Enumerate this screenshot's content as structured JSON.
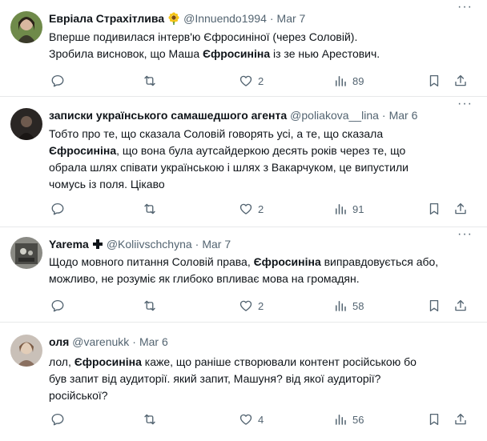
{
  "tweets": [
    {
      "name": "Евріала Страхітлива",
      "handle": "@Innuendo1994",
      "separator": "·",
      "date": "Mar 7",
      "badge_icon": "sunflower-emoji",
      "text_parts": [
        {
          "t": "Вперше подивилася інтерв'ю Єфросиніної (через Соловій).\nЗробила висновок, що Маша "
        },
        {
          "t": "Єфросиніна",
          "b": true
        },
        {
          "t": " із зе нью Арестович."
        }
      ],
      "likes": "2",
      "views": "89"
    },
    {
      "name": "записки українського самашедшого агента",
      "handle": "@poliakova__lina",
      "separator": "·",
      "date": "Mar 6",
      "text_parts": [
        {
          "t": "Тобто про те, що сказала Соловій говорять усі, а те, що сказала\n"
        },
        {
          "t": "Єфросиніна",
          "b": true
        },
        {
          "t": ", що вона була аутсайдеркою десять років через те, що\nобрала шлях співати українською і шлях з Вакарчуком, це випустили\nчомусь із поля. Цікаво"
        }
      ],
      "likes": "2",
      "views": "91"
    },
    {
      "name": "Yarema",
      "handle": "@Koliivschchyna",
      "separator": "·",
      "date": "Mar 7",
      "badge_icon": "cross-plus-icon",
      "text_parts": [
        {
          "t": "Щодо мовного питання Соловій права, "
        },
        {
          "t": "Єфросиніна",
          "b": true
        },
        {
          "t": " виправдовується або,\nможливо, не розуміє як глибоко впливає мова на громадян."
        }
      ],
      "likes": "2",
      "views": "58"
    },
    {
      "name": "оля",
      "handle": "@varenukk",
      "separator": "·",
      "date": "Mar 6",
      "text_parts": [
        {
          "t": "лол, "
        },
        {
          "t": "Єфросиніна",
          "b": true
        },
        {
          "t": " каже, що раніше створювали контент російською бо\nбув запит від аудиторії. який запит, Машуня? від якої аудиторії?\nросійської?"
        }
      ],
      "likes": "4",
      "views": "56"
    }
  ],
  "more_glyph": "···",
  "colors": {
    "text": "#0f1419",
    "secondary": "#536471",
    "divider": "#e7e9ea"
  }
}
